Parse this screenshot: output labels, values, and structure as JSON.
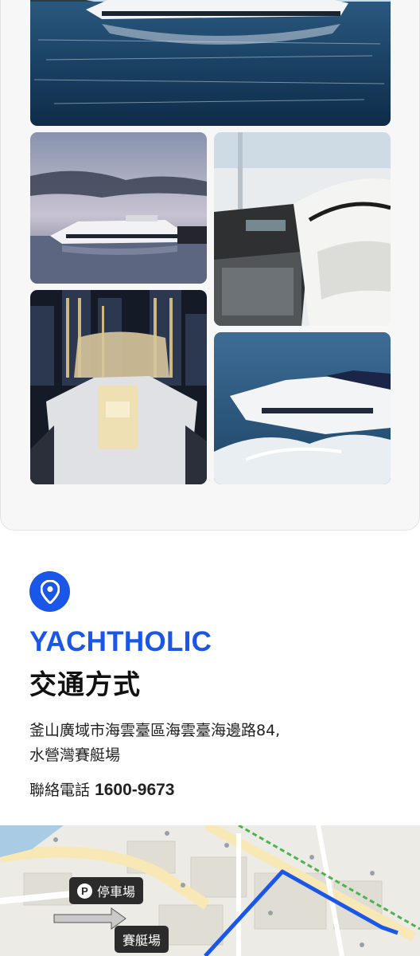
{
  "gallery": {
    "photos": [
      {
        "name": "yacht-bay-photo"
      },
      {
        "name": "yacht-dusk-photo"
      },
      {
        "name": "yacht-interior-seating-photo"
      },
      {
        "name": "yacht-night-city-photo"
      },
      {
        "name": "yacht-cruising-photo"
      }
    ]
  },
  "info": {
    "icon": "location-pin-icon",
    "brand": "YACHTHOLIC",
    "heading": "交通方式",
    "address_line1": "釜山廣域市海雲臺區海雲臺海邊路84,",
    "address_line2": "水營灣賽艇場",
    "phone_label": "聯絡電話",
    "phone_number": "1600-9673"
  },
  "map": {
    "parking_badge": "P",
    "parking_label": "停車場",
    "marina_label": "賽艇場"
  },
  "colors": {
    "accent": "#1a57e8",
    "label_bg": "#2b2b2b"
  }
}
